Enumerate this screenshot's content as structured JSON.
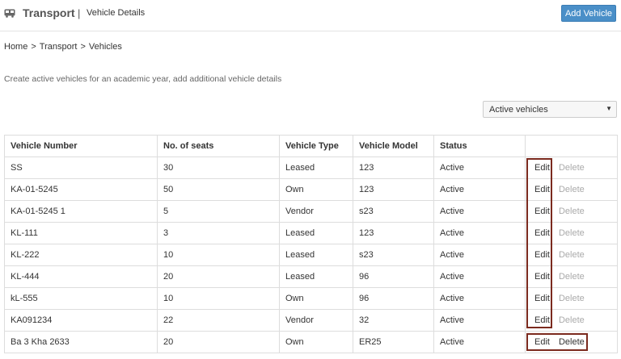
{
  "header": {
    "icon": "bus-icon",
    "title": "Transport",
    "separator": "|",
    "subtitle": "Vehicle Details",
    "add_button": "Add Vehicle",
    "accent": "#4a8fc8"
  },
  "breadcrumb": {
    "items": [
      "Home",
      "Transport",
      "Vehicles"
    ],
    "separator": ">"
  },
  "description": "Create active vehicles for an academic year, add additional vehicle details",
  "filter": {
    "selected": "Active vehicles"
  },
  "table": {
    "columns": [
      "Vehicle Number",
      "No. of seats",
      "Vehicle Type",
      "Vehicle Model",
      "Status",
      ""
    ],
    "rows": [
      {
        "number": "SS",
        "seats": "30",
        "type": "Leased",
        "model": "123",
        "status": "Active",
        "edit": "Edit",
        "delete": "Delete"
      },
      {
        "number": "KA-01-5245",
        "seats": "50",
        "type": "Own",
        "model": "123",
        "status": "Active",
        "edit": "Edit",
        "delete": "Delete"
      },
      {
        "number": "KA-01-5245 1",
        "seats": "5",
        "type": "Vendor",
        "model": "s23",
        "status": "Active",
        "edit": "Edit",
        "delete": "Delete"
      },
      {
        "number": "KL-111",
        "seats": "3",
        "type": "Leased",
        "model": "123",
        "status": "Active",
        "edit": "Edit",
        "delete": "Delete"
      },
      {
        "number": "KL-222",
        "seats": "10",
        "type": "Leased",
        "model": "s23",
        "status": "Active",
        "edit": "Edit",
        "delete": "Delete"
      },
      {
        "number": "KL-444",
        "seats": "20",
        "type": "Leased",
        "model": "96",
        "status": "Active",
        "edit": "Edit",
        "delete": "Delete"
      },
      {
        "number": "kL-555",
        "seats": "10",
        "type": "Own",
        "model": "96",
        "status": "Active",
        "edit": "Edit",
        "delete": "Delete"
      },
      {
        "number": "KA091234",
        "seats": "22",
        "type": "Vendor",
        "model": "32",
        "status": "Active",
        "edit": "Edit",
        "delete": "Delete"
      },
      {
        "number": "Ba 3 Kha 2633",
        "seats": "20",
        "type": "Own",
        "model": "ER25",
        "status": "Active",
        "edit": "Edit",
        "delete": "Delete"
      }
    ]
  },
  "colors": {
    "highlight": "#7b2a1e",
    "delete_disabled": "#aaaaaa",
    "border": "#dddddd"
  }
}
